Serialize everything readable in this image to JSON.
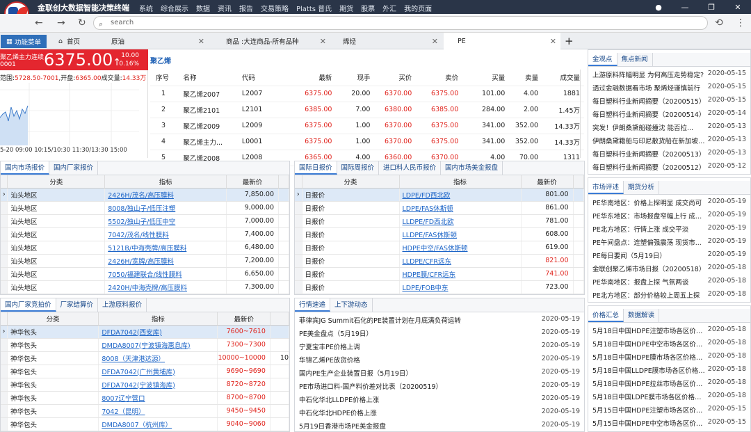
{
  "app": {
    "title": "金联创大数据智能决策终端",
    "menu": [
      "系统",
      "综合展示",
      "数据",
      "资讯",
      "报告",
      "交易策略",
      "Platts 普氏",
      "期货",
      "股票",
      "外汇",
      "我的页面"
    ]
  },
  "browser": {
    "search_placeholder": "search"
  },
  "tabs": [
    {
      "label": "首页"
    },
    {
      "label": "原油"
    },
    {
      "label": "商品 :大连商品-所有品种"
    },
    {
      "label": "烯烃"
    },
    {
      "label": "PE"
    }
  ],
  "func_button": "功能菜单",
  "quote": {
    "name": "聚乙烯主力连续",
    "code": "0001",
    "price": "6375.00",
    "arrow": "↑",
    "change": "10.00",
    "pct": "0.16%",
    "info_label": "范围:",
    "range": "5728.50-7001",
    "open_label": "开盘:",
    "open": "6365.00",
    "vol_label": "成交量:",
    "vol": "14.33万",
    "ticks": "5-20 09:00    10:15/10:30    11:30/13:30    15:00"
  },
  "pe_title": "聚乙烯",
  "main_table": {
    "headers": [
      "序号",
      "名称",
      "代码",
      "最新",
      "现手",
      "买价",
      "卖价",
      "买量",
      "卖量",
      "成交量"
    ],
    "rows": [
      [
        "1",
        "聚乙烯2007",
        "L2007",
        "6375.00",
        "20.00",
        "6370.00",
        "6375.00",
        "101.00",
        "4.00",
        "1881"
      ],
      [
        "2",
        "聚乙烯2101",
        "L2101",
        "6385.00",
        "7.00",
        "6380.00",
        "6385.00",
        "284.00",
        "2.00",
        "1.45万"
      ],
      [
        "3",
        "聚乙烯2009",
        "L2009",
        "6375.00",
        "1.00",
        "6370.00",
        "6375.00",
        "341.00",
        "352.00",
        "14.33万"
      ],
      [
        "4",
        "聚乙烯主力...",
        "L0001",
        "6375.00",
        "1.00",
        "6370.00",
        "6375.00",
        "341.00",
        "352.00",
        "14.33万"
      ],
      [
        "5",
        "聚乙烯2008",
        "L2008",
        "6365.00",
        "4.00",
        "6360.00",
        "6370.00",
        "4.00",
        "70.00",
        "1311"
      ]
    ]
  },
  "p1": {
    "tabs": [
      "国内市场报价",
      "国内厂家报价"
    ],
    "headers": [
      "分类",
      "指标",
      "最新价"
    ],
    "rows": [
      [
        "汕头地区",
        "2426H/茂名/高压膜料",
        "7,850.00"
      ],
      [
        "汕头地区",
        "8008/独山子/低压注塑",
        "9,000.00"
      ],
      [
        "汕头地区",
        "5502/独山子/低压中空",
        "7,000.00"
      ],
      [
        "汕头地区",
        "7042/茂名/线性膜料",
        "7,400.00"
      ],
      [
        "汕头地区",
        "5121B/中海壳牌/高压膜料",
        "6,480.00"
      ],
      [
        "汕头地区",
        "2426H/宽牌/高压膜料",
        "7,200.00"
      ],
      [
        "汕头地区",
        "7050/福建联合/线性膜料",
        "6,650.00"
      ],
      [
        "汕头地区",
        "2420H/中海壳牌/高压膜料",
        "7,300.00"
      ]
    ]
  },
  "p2": {
    "tabs": [
      "国际日报价",
      "国际周报价",
      "进口料人民币报价",
      "国内市场美金报盘"
    ],
    "headers": [
      "分类",
      "指标",
      "最新价"
    ],
    "rows": [
      [
        "日报价",
        "LDPE/FD西北欧",
        "801.00",
        "blk"
      ],
      [
        "日报价",
        "LDPE/FAS休斯顿",
        "861.00",
        "blk"
      ],
      [
        "日报价",
        "LLDPE/FD西北欧",
        "781.00",
        "blk"
      ],
      [
        "日报价",
        "LLDPE/FAS休斯顿",
        "608.00",
        "blk"
      ],
      [
        "日报价",
        "HDPE中空/FAS休斯顿",
        "619.00",
        "blk"
      ],
      [
        "日报价",
        "LLDPE/CFR远东",
        "821.00",
        "red"
      ],
      [
        "日报价",
        "HDPE膜/CFR远东",
        "741.00",
        "red"
      ],
      [
        "日报价",
        "LDPE/FOB中东",
        "723.00",
        "blk"
      ]
    ]
  },
  "p3": {
    "tabs": [
      "国内厂家竞拍价",
      "厂家结算价",
      "上游原料报价"
    ],
    "headers": [
      "分类",
      "指标",
      "最新价"
    ],
    "rows": [
      [
        "神华包头",
        "DFDA7042(西安库)",
        "7600~7610"
      ],
      [
        "神华包头",
        "DMDA8007(宁波镇海惠息库)",
        "7300~7300"
      ],
      [
        "神华包头",
        "8008（天津港达源）",
        "10000~10000",
        "10"
      ],
      [
        "神华包头",
        "DFDA7042(广州黄埔库)",
        "9690~9690"
      ],
      [
        "神华包头",
        "DFDA7042(宁波镇海库)",
        "8720~8720"
      ],
      [
        "神华包头",
        "8007辽宁营口",
        "8700~8700"
      ],
      [
        "神华包头",
        "7042（昆明）",
        "9450~9450"
      ],
      [
        "神华包头",
        "DMDA8007（杭州库）",
        "9040~9060"
      ]
    ]
  },
  "p4": {
    "tabs": [
      "行情速递",
      "上下游动态"
    ],
    "items": [
      [
        "菲律宾JG Summit石化的PE装置计划在月底满负荷运转",
        "2020-05-19"
      ],
      [
        "PE美金盘点（5月19日）",
        "2020-05-19"
      ],
      [
        "宁夏宝丰PE价格上调",
        "2020-05-19"
      ],
      [
        "华锦乙烯PE放货价格",
        "2020-05-19"
      ],
      [
        "国内PE生产企业装置日报（5月19日）",
        "2020-05-19"
      ],
      [
        "PE市场进口料-国产料价差对比表（20200519）",
        "2020-05-19"
      ],
      [
        "中石化华北LLDPE价格上涨",
        "2020-05-19"
      ],
      [
        "中石化华北HDPE价格上涨",
        "2020-05-19"
      ],
      [
        "5月19日香港市场PE美金报盘",
        "2020-05-19"
      ]
    ]
  },
  "r1": {
    "tabs": [
      "金观点",
      "焦点新闻"
    ],
    "items": [
      [
        "上游原料阵幅明显 为何高压走势稳定?",
        "2020-05-15"
      ],
      [
        "透过金融数据看市场 聚烯烃谨慎前行",
        "2020-05-15"
      ],
      [
        "每日塑料行业新闻摘要（20200515）",
        "2020-05-15"
      ],
      [
        "每日塑料行业新闻摘要（20200514）",
        "2020-05-14"
      ],
      [
        "突发！伊朗桑黛船碰撞沈 能否拉...",
        "2020-05-13"
      ],
      [
        "伊朗桑黛籍船与印尼散货船在新加坡海...",
        "2020-05-13"
      ],
      [
        "每日塑料行业新闻摘要（20200513）",
        "2020-05-13"
      ],
      [
        "每日塑料行业新闻摘要（20200512）",
        "2020-05-12"
      ]
    ]
  },
  "r2": {
    "tabs": [
      "市场评述",
      "期货分析"
    ],
    "items": [
      [
        "PE华南地区：价格上探明显 成交尚可",
        "2020-05-19"
      ],
      [
        "PE华东地区：市场报盘窄幅上行 成交...",
        "2020-05-19"
      ],
      [
        "PE北方地区：行情上涨 成交平淡",
        "2020-05-19"
      ],
      [
        "PE午间盘点：连塑偏强震荡 现货市...",
        "2020-05-19"
      ],
      [
        "PE每日要闻（5月19日）",
        "2020-05-19"
      ],
      [
        "金联创聚乙烯市场日报（20200518）",
        "2020-05-18"
      ],
      [
        "PE华南地区：报盘上探 气氛两谈",
        "2020-05-18"
      ],
      [
        "PE北方地区：部分价格较上周五上探",
        "2020-05-18"
      ]
    ]
  },
  "r3": {
    "tabs": [
      "价格汇总",
      "数据解读"
    ],
    "items": [
      [
        "5月18日中国HDPE注塑市场各区价格...",
        "2020-05-18"
      ],
      [
        "5月18日中国HDPE中空市场各区价格...",
        "2020-05-18"
      ],
      [
        "5月18日中国HDPE膜市场各区价格汇总",
        "2020-05-18"
      ],
      [
        "5月18日中国LLDPE膜市场各区价格汇总",
        "2020-05-18"
      ],
      [
        "5月18日中国HDPE拉丝市场各区价格...",
        "2020-05-18"
      ],
      [
        "5月18日中国LDPE膜市场各区价格汇总",
        "2020-05-18"
      ],
      [
        "5月15日中国HDPE注塑市场各区价格...",
        "2020-05-15"
      ],
      [
        "5月15日中国HDPE中空市场各区价格...",
        "2020-05-15"
      ]
    ]
  }
}
